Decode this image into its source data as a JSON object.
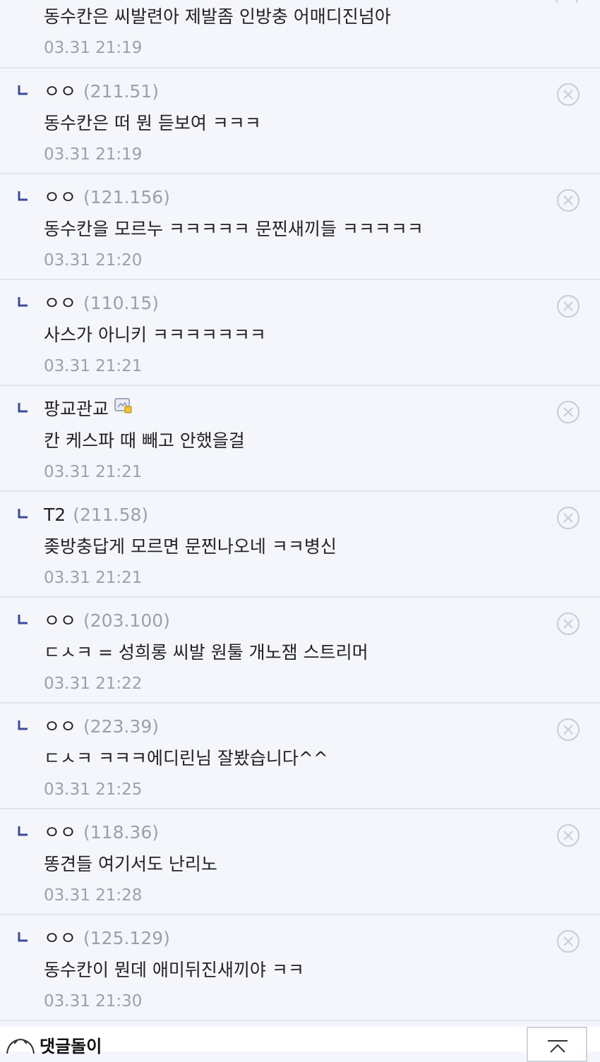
{
  "comments": [
    {
      "nick": "",
      "ip": "",
      "text": "동수칸은 씨발련아 제발좀 인방충 어매디진넘아",
      "date": "03.31 21:19"
    },
    {
      "nick": "ㅇㅇ",
      "ip": "(211.51)",
      "text": "동수칸은 떠 뭔 듣보여 ㅋㅋㅋ",
      "date": "03.31 21:19"
    },
    {
      "nick": "ㅇㅇ",
      "ip": "(121.156)",
      "text": "동수칸을 모르누 ㅋㅋㅋㅋㅋ 문찐새끼들 ㅋㅋㅋㅋㅋ",
      "date": "03.31 21:20"
    },
    {
      "nick": "ㅇㅇ",
      "ip": "(110.15)",
      "text": "사스가 아니키 ㅋㅋㅋㅋㅋㅋㅋ",
      "date": "03.31 21:21"
    },
    {
      "nick": "팡교관교",
      "ip": "",
      "text": "칸 케스파 때 빼고 안했을걸",
      "date": "03.31 21:21"
    },
    {
      "nick": "T2",
      "ip": "(211.58)",
      "text": "좆방충답게 모르면 문찐나오네 ㅋㅋ병신",
      "date": "03.31 21:21"
    },
    {
      "nick": "ㅇㅇ",
      "ip": "(203.100)",
      "text": "ㄷㅅㅋ = 성희롱 씨발 원툴 개노잼 스트리머",
      "date": "03.31 21:22"
    },
    {
      "nick": "ㅇㅇ",
      "ip": "(223.39)",
      "text": "ㄷㅅㅋ ㅋㅋㅋ에디린님 잘봤습니다^^",
      "date": "03.31 21:25"
    },
    {
      "nick": "ㅇㅇ",
      "ip": "(118.36)",
      "text": "똥견들 여기서도 난리노",
      "date": "03.31 21:28"
    },
    {
      "nick": "ㅇㅇ",
      "ip": "(125.129)",
      "text": "동수칸이 뭔데 애미뒤진새끼야 ㅋㅋ",
      "date": "03.31 21:30"
    }
  ],
  "footer": {
    "title": "댓글돌이"
  },
  "icons": {
    "reply": "reply-arrow-icon",
    "delete": "delete-circle-x-icon",
    "badge": "fixed-nick-badge-icon",
    "scroll_top": "scroll-top-icon",
    "bot": "comment-bot-icon"
  },
  "colors": {
    "background": "#f4f6fb",
    "reply_icon": "#3b4a9c",
    "meta_text": "#9aa0ad",
    "divider": "#e1e5ee"
  }
}
